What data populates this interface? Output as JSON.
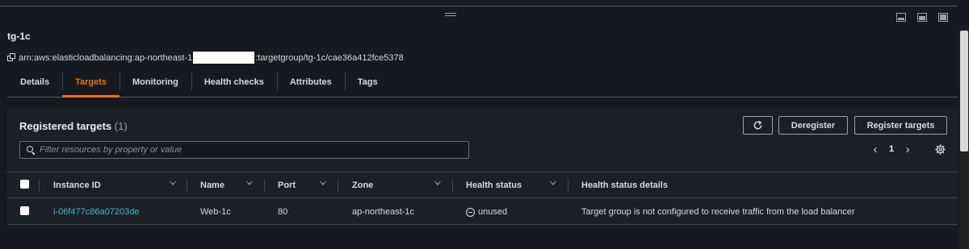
{
  "target_group": {
    "name": "tg-1c",
    "arn_prefix": "arn:aws:elasticloadbalancing:ap-northeast-1",
    "arn_suffix": ":targetgroup/tg-1c/cae36a412fce5378"
  },
  "tabs": [
    {
      "label": "Details",
      "active": false
    },
    {
      "label": "Targets",
      "active": true
    },
    {
      "label": "Monitoring",
      "active": false
    },
    {
      "label": "Health checks",
      "active": false
    },
    {
      "label": "Attributes",
      "active": false
    },
    {
      "label": "Tags",
      "active": false
    }
  ],
  "panel": {
    "title": "Registered targets",
    "count": "(1)",
    "deregister_label": "Deregister",
    "register_label": "Register targets",
    "search_placeholder": "Filter resources by property or value",
    "page": "1"
  },
  "table": {
    "columns": [
      "Instance ID",
      "Name",
      "Port",
      "Zone",
      "Health status",
      "Health status details"
    ],
    "rows": [
      {
        "instance_id": "i-06f477c86a07203de",
        "name": "Web-1c",
        "port": "80",
        "zone": "ap-northeast-1c",
        "health_status": "unused",
        "health_details": "Target group is not configured to receive traffic from the load balancer"
      }
    ]
  },
  "colors": {
    "accent": "#ec7211",
    "link": "#44b9d6",
    "background": "#16191f"
  }
}
